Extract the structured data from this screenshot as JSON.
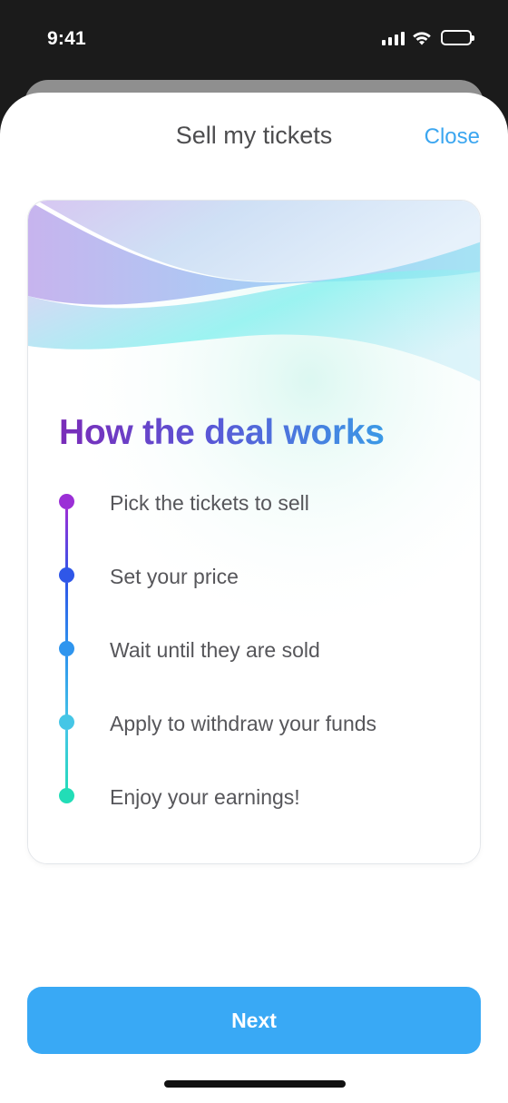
{
  "status_bar": {
    "time": "9:41",
    "icons": [
      "signal-icon",
      "wifi-icon",
      "battery-icon"
    ]
  },
  "header": {
    "title": "Sell my tickets",
    "close_label": "Close"
  },
  "card": {
    "title": "How the deal works",
    "steps": [
      {
        "label": "Pick the tickets to sell",
        "color": "#9b2fd6"
      },
      {
        "label": "Set your price",
        "color": "#2f57e8"
      },
      {
        "label": "Wait until they are sold",
        "color": "#2f95ee"
      },
      {
        "label": "Apply to withdraw your funds",
        "color": "#45c6e6"
      },
      {
        "label": "Enjoy your earnings!",
        "color": "#22ddb7"
      }
    ]
  },
  "footer": {
    "next_label": "Next"
  },
  "colors": {
    "accent": "#39a9f5",
    "close_link": "#3ba6f0",
    "title_text": "#4d4d4f"
  }
}
